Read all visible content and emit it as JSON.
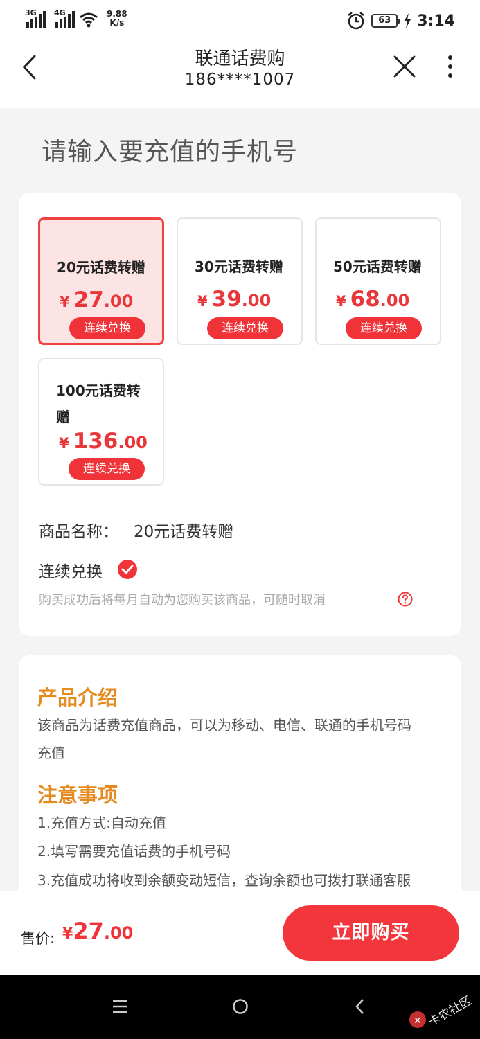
{
  "status_bar": {
    "network_1": "3G",
    "network_2": "4G",
    "speed_value": "9.88",
    "speed_unit": "K/s",
    "battery": "63",
    "time": "3:14"
  },
  "header": {
    "title": "联通话费购",
    "phone": "186****1007"
  },
  "prompt": "请输入要充值的手机号",
  "products": [
    {
      "name": "20元话费转赠",
      "currency": "¥",
      "price_int": "27",
      "price_dec": ".00",
      "tag": "连续兑换",
      "selected": true
    },
    {
      "name": "30元话费转赠",
      "currency": "¥",
      "price_int": "39",
      "price_dec": ".00",
      "tag": "连续兑换",
      "selected": false
    },
    {
      "name": "50元话费转赠",
      "currency": "¥",
      "price_int": "68",
      "price_dec": ".00",
      "tag": "连续兑换",
      "selected": false
    },
    {
      "name": "100元话费转赠",
      "currency": "¥",
      "price_int": "136",
      "price_dec": ".00",
      "tag": "连续兑换",
      "selected": false
    }
  ],
  "product_name_label": "商品名称：",
  "product_name_value": "20元话费转赠",
  "continuous": {
    "label": "连续兑换",
    "checked": true,
    "description": "购买成功后将每月自动为您购买该商品，可随时取消"
  },
  "intro": {
    "title": "产品介绍",
    "text_1": "该商品为话费充值商品，可以为移动、电信、联通的手机号码",
    "text_2": "充值"
  },
  "notes": {
    "title": "注意事项",
    "items": [
      "1.充值方式:自动充值",
      "2.填写需要充值话费的手机号码",
      "3.充值成功将收到余额变动短信，查询余额也可拨打联通客服"
    ]
  },
  "bottom": {
    "sale_label": "售价:",
    "currency": "¥",
    "price_int": "27",
    "price_dec": ".00",
    "buy_button": "立即购买"
  },
  "watermark": "卡农社区",
  "colors": {
    "accent": "#ef3338",
    "price": "#e8373a",
    "section_title": "#e58a1f",
    "selected_bg": "#fde4e4"
  },
  "icons": [
    "back-icon",
    "close-icon",
    "more-icon",
    "check-circle-icon",
    "help-circle-icon",
    "wifi-icon",
    "alarm-icon",
    "charging-icon",
    "menu-icon",
    "home-icon",
    "nav-back-icon"
  ]
}
